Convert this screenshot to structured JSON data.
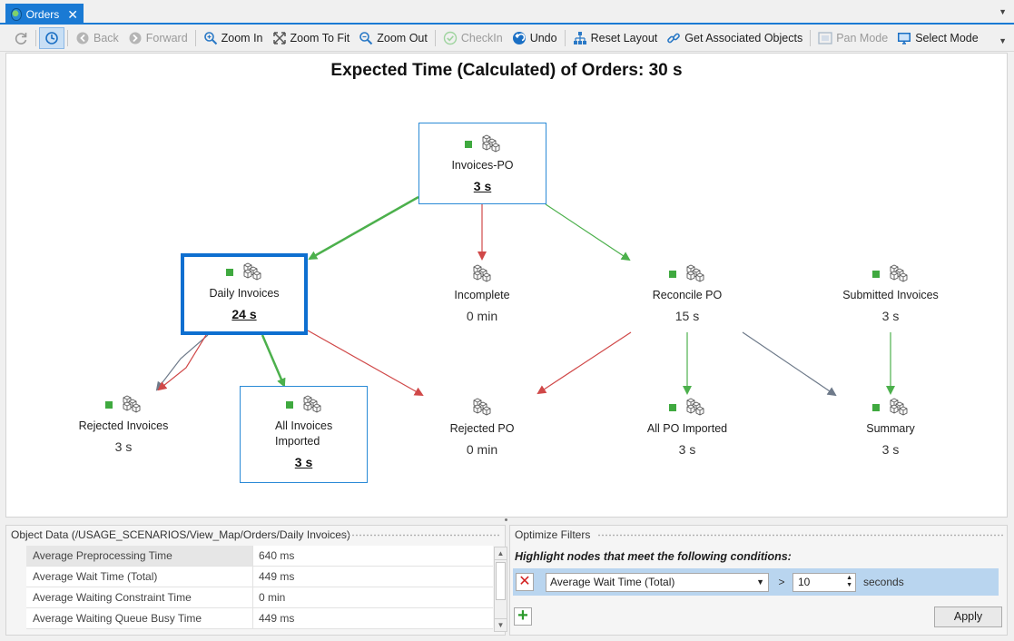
{
  "tab": {
    "title": "Orders",
    "close_glyph": "✕"
  },
  "toolbar": {
    "back": "Back",
    "forward": "Forward",
    "zoom_in": "Zoom In",
    "zoom_to_fit": "Zoom To Fit",
    "zoom_out": "Zoom Out",
    "checkin": "CheckIn",
    "undo": "Undo",
    "reset_layout": "Reset Layout",
    "get_associated": "Get Associated Objects",
    "pan_mode": "Pan Mode",
    "select_mode": "Select Mode"
  },
  "canvas": {
    "title": "Expected Time (Calculated) of Orders: 30 s"
  },
  "nodes": {
    "invoices_po": {
      "label": "Invoices-PO",
      "value": "3 s"
    },
    "daily_invoices": {
      "label": "Daily Invoices",
      "value": "24 s"
    },
    "incomplete": {
      "label": "Incomplete",
      "value": "0 min"
    },
    "reconcile_po": {
      "label": "Reconcile PO",
      "value": "15 s"
    },
    "submitted_invoices": {
      "label": "Submitted Invoices",
      "value": "3 s"
    },
    "rejected_invoices": {
      "label": "Rejected Invoices",
      "value": "3 s"
    },
    "all_invoices_imported": {
      "label1": "All Invoices",
      "label2": "Imported",
      "value": "3 s"
    },
    "rejected_po": {
      "label": "Rejected PO",
      "value": "0 min"
    },
    "all_po_imported": {
      "label": "All PO Imported",
      "value": "3 s"
    },
    "summary": {
      "label": "Summary",
      "value": "3 s"
    }
  },
  "object_data": {
    "header": "Object Data (/USAGE_SCENARIOS/View_Map/Orders/Daily Invoices)",
    "rows": [
      {
        "name": "Average Preprocessing Time",
        "value": "640 ms"
      },
      {
        "name": "Average Wait Time (Total)",
        "value": "449 ms"
      },
      {
        "name": "Average Waiting Constraint Time",
        "value": "0 min"
      },
      {
        "name": "Average Waiting Queue Busy Time",
        "value": "449 ms"
      }
    ]
  },
  "filters": {
    "header": "Optimize Filters",
    "instruction": "Highlight nodes that meet the following conditions:",
    "condition": {
      "metric": "Average Wait Time (Total)",
      "operator": ">",
      "threshold": "10",
      "unit": "seconds"
    },
    "remove_glyph": "✕",
    "add_glyph": "+",
    "apply_label": "Apply"
  },
  "colors": {
    "accent": "#1a7ad4",
    "edge_green": "#4cb04c",
    "edge_red": "#d04848",
    "edge_gray": "#6e7a8a",
    "status_green": "#3fa93f"
  }
}
